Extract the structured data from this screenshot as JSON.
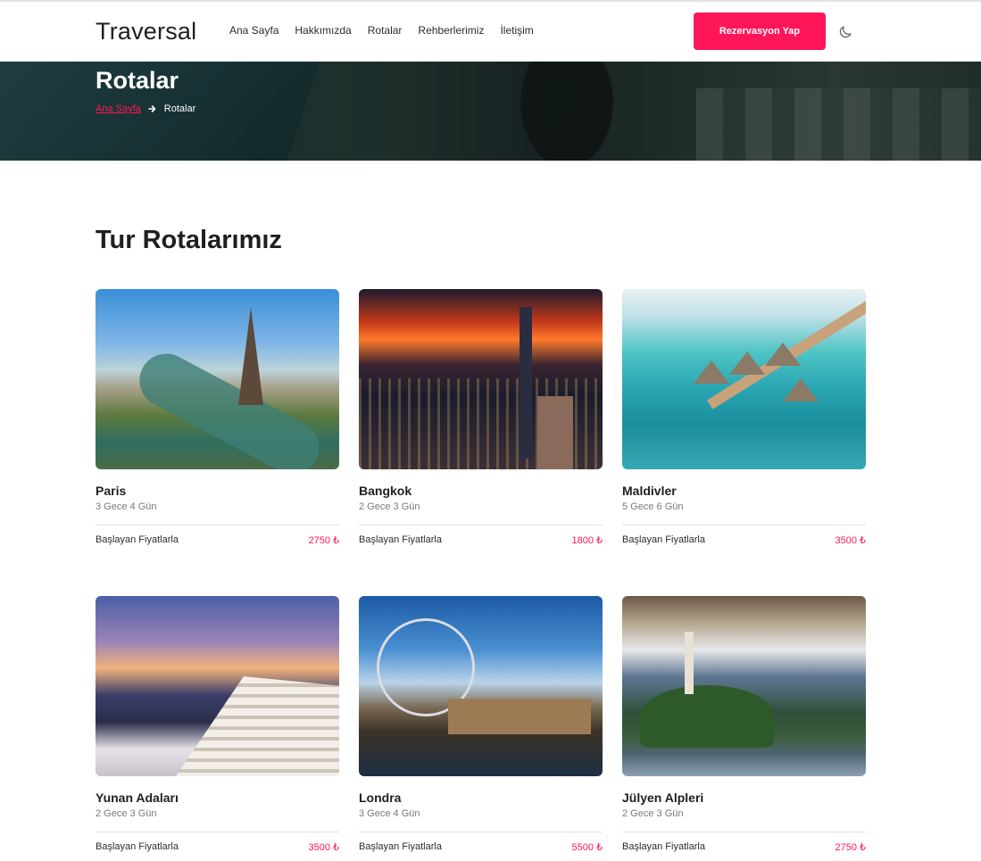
{
  "brand": "Traversal",
  "nav": {
    "items": [
      "Ana Sayfa",
      "Hakkımızda",
      "Rotalar",
      "Rehberlerimiz",
      "İletişim"
    ],
    "cta_label": "Rezervasyon Yap"
  },
  "hero": {
    "title": "Rotalar",
    "breadcrumb": {
      "home": "Ana Sayfa",
      "current": "Rotalar"
    }
  },
  "section_title": "Tur Rotalarımız",
  "tours": [
    {
      "name": "Paris",
      "duration": "3 Gece 4 Gün",
      "price_label": "Başlayan Fiyatlarla",
      "price": "2750 ₺"
    },
    {
      "name": "Bangkok",
      "duration": "2 Gece 3 Gün",
      "price_label": "Başlayan Fiyatlarla",
      "price": "1800 ₺"
    },
    {
      "name": "Maldivler",
      "duration": "5 Gece 6 Gün",
      "price_label": "Başlayan Fiyatlarla",
      "price": "3500 ₺"
    },
    {
      "name": "Yunan Adaları",
      "duration": "2 Gece 3 Gün",
      "price_label": "Başlayan Fiyatlarla",
      "price": "3500 ₺"
    },
    {
      "name": "Londra",
      "duration": "3 Gece 4 Gün",
      "price_label": "Başlayan Fiyatlarla",
      "price": "5500 ₺"
    },
    {
      "name": "Jülyen Alpleri",
      "duration": "2 Gece 3 Gün",
      "price_label": "Başlayan Fiyatlarla",
      "price": "2750 ₺"
    }
  ],
  "colors": {
    "accent": "#ff1659",
    "text": "#1f1f1f",
    "muted": "#7a7a7a"
  },
  "icons": {
    "theme_toggle": "moon-icon",
    "breadcrumb_separator": "arrow-right-icon"
  }
}
